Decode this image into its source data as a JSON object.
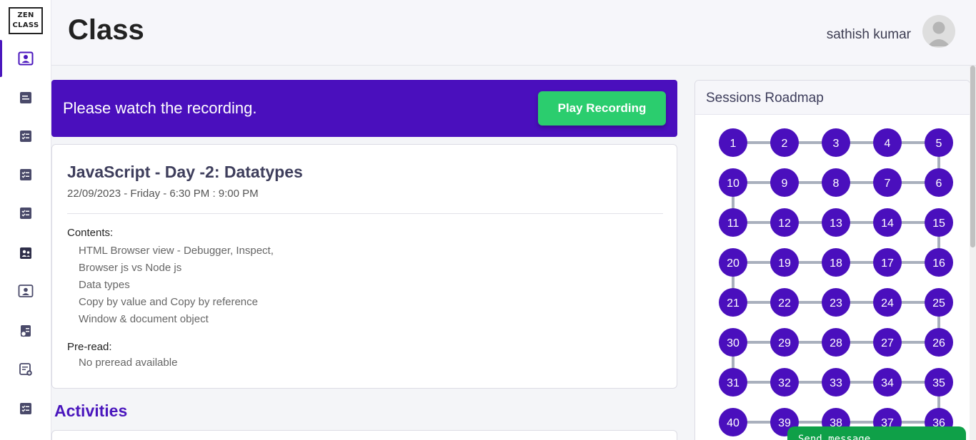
{
  "logo": {
    "line1": "ZEN",
    "line2": "CLASS"
  },
  "header": {
    "title": "Class",
    "user_name": "sathish kumar"
  },
  "banner": {
    "message": "Please watch the recording.",
    "button_label": "Play Recording"
  },
  "class_card": {
    "title": "JavaScript - Day -2: Datatypes",
    "date": "22/09/2023 - Friday - 6:30 PM : 9:00 PM",
    "contents_label": "Contents:",
    "contents": [
      "HTML Browser view - Debugger, Inspect,",
      "Browser js vs Node js",
      "Data types",
      "Copy by value and Copy by reference",
      "Window & document object"
    ],
    "preread_label": "Pre-read:",
    "preread_text": "No preread available"
  },
  "activities": {
    "title": "Activities"
  },
  "roadmap": {
    "title": "Sessions Roadmap",
    "rows": [
      [
        1,
        2,
        3,
        4,
        5
      ],
      [
        10,
        9,
        8,
        7,
        6
      ],
      [
        11,
        12,
        13,
        14,
        15
      ],
      [
        20,
        19,
        18,
        17,
        16
      ],
      [
        21,
        22,
        23,
        24,
        25
      ],
      [
        30,
        29,
        28,
        27,
        26
      ],
      [
        31,
        32,
        33,
        34,
        35
      ],
      [
        40,
        39,
        38,
        37,
        36
      ]
    ]
  },
  "send_message": {
    "label": "Send message"
  },
  "colors": {
    "accent": "#4a0fbd",
    "play_button": "#2bcd6e",
    "send_message": "#0fa048"
  }
}
